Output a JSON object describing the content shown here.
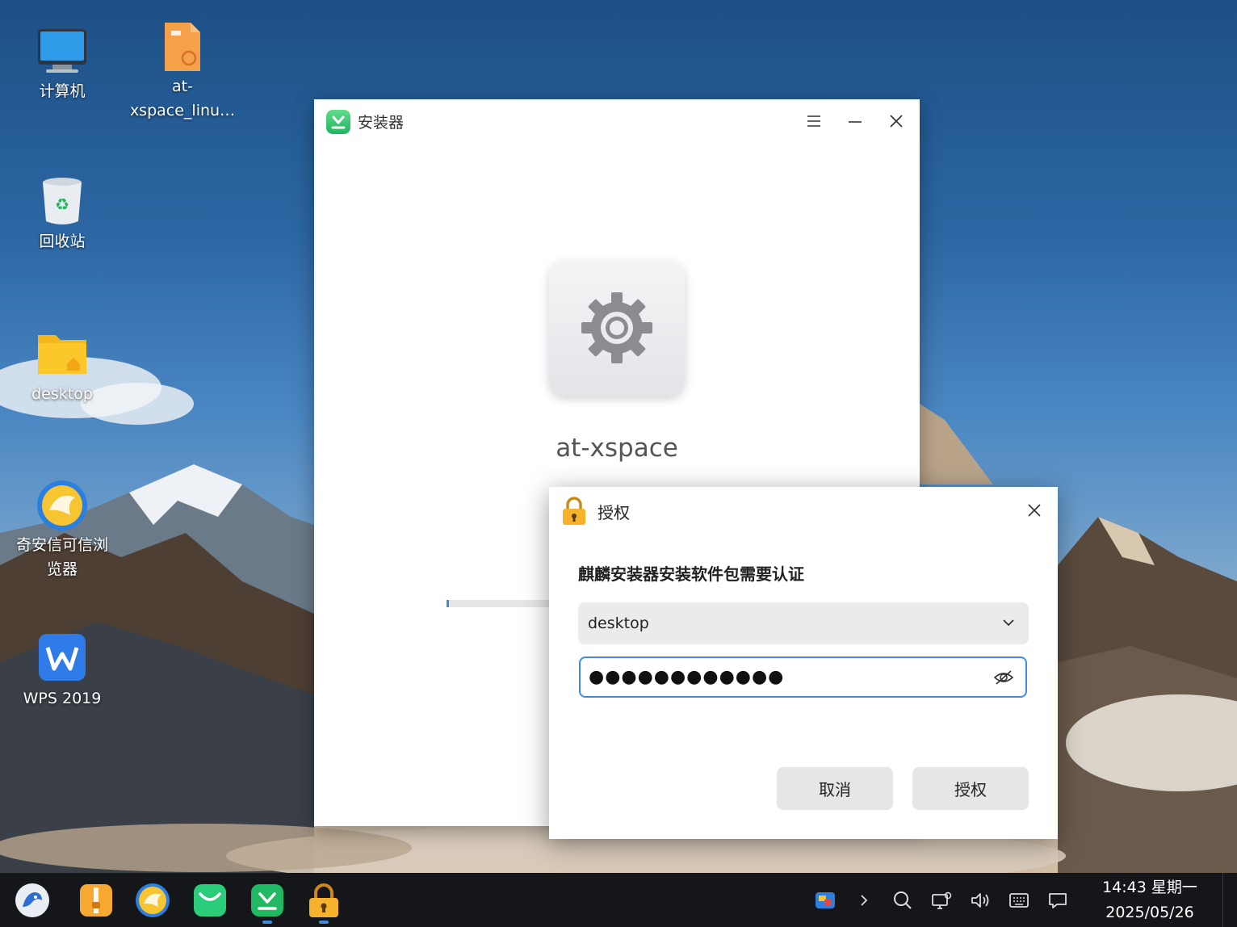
{
  "desktop": {
    "icons": [
      {
        "label": "计算机"
      },
      {
        "label_line1": "at-",
        "label_line2": "xspace_linu…"
      },
      {
        "label": "回收站"
      },
      {
        "label": "desktop"
      },
      {
        "label_line1": "奇安信可信浏",
        "label_line2": "览器"
      },
      {
        "label": "WPS 2019"
      }
    ]
  },
  "installer": {
    "title": "安装器",
    "package_name": "at-xspace",
    "progress": 0.02
  },
  "auth_dialog": {
    "title": "授权",
    "prompt": "麒麟安装器安装软件包需要认证",
    "user": "desktop",
    "password_mask": "●●●●●●●●●●●●",
    "cancel_label": "取消",
    "authorize_label": "授权"
  },
  "taskbar": {
    "time": "14:43 星期一",
    "date": "2025/05/26"
  },
  "colors": {
    "accent": "#3d8be4",
    "installer_green": "#1fb560"
  }
}
